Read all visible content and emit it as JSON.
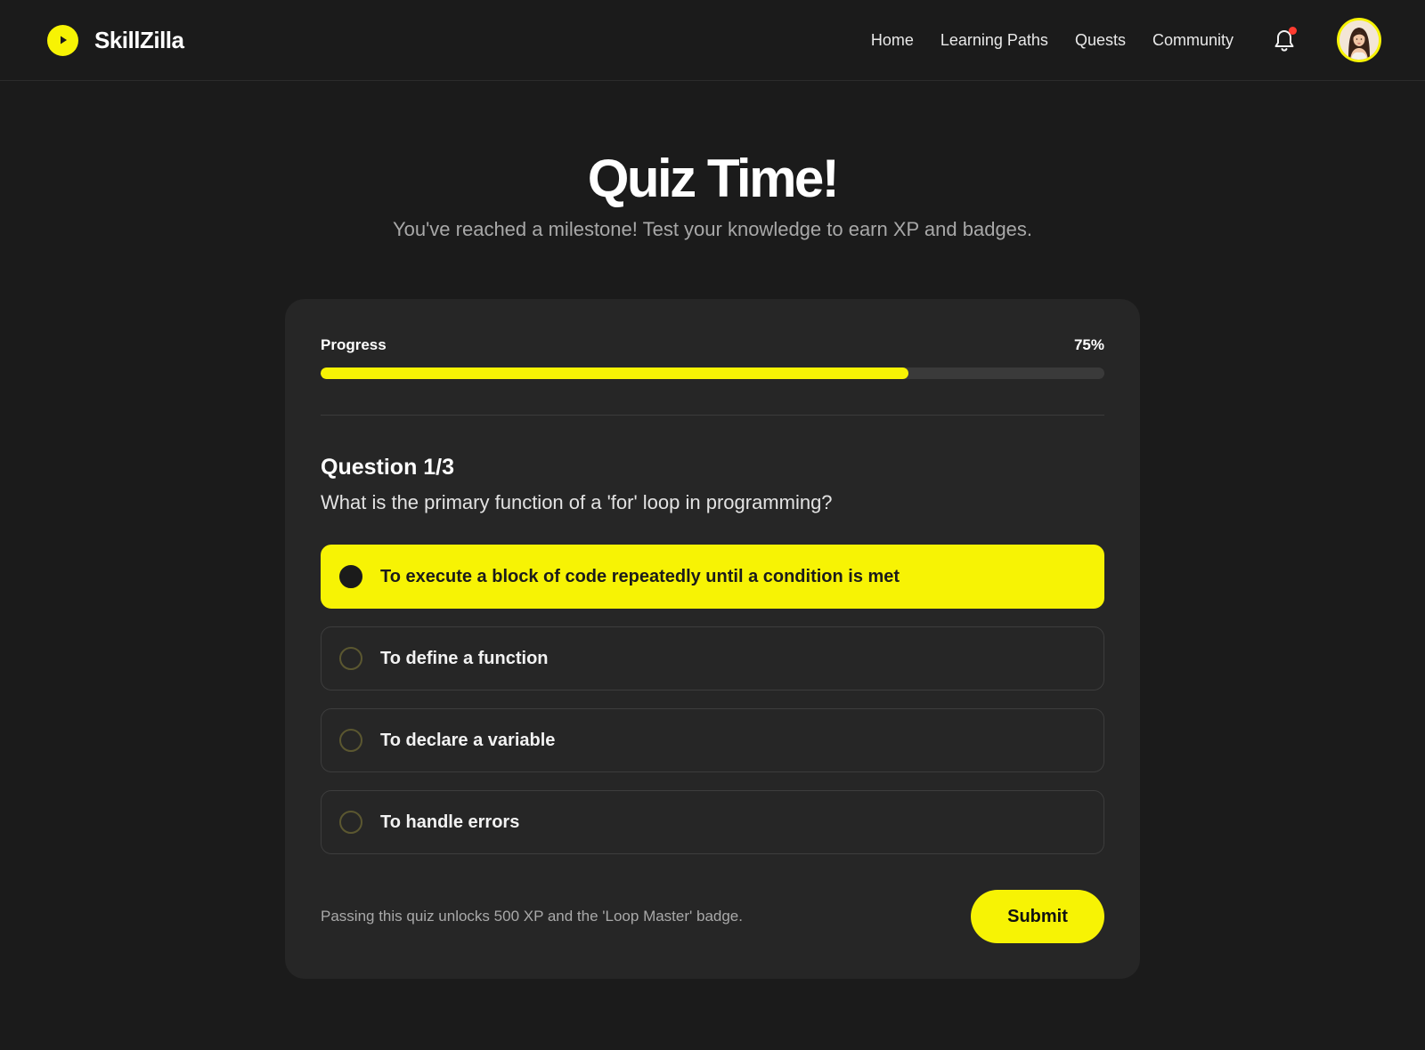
{
  "brand": {
    "name": "SkillZilla",
    "logo_icon": "play-icon",
    "accent": "#f7f304"
  },
  "nav": {
    "links": [
      "Home",
      "Learning Paths",
      "Quests",
      "Community"
    ],
    "notification_icon": "bell-icon",
    "has_unread": true,
    "avatar_icon": "user-avatar"
  },
  "hero": {
    "title": "Quiz Time!",
    "subtitle": "You've reached a milestone! Test your knowledge to earn XP and badges."
  },
  "quiz": {
    "progress_label": "Progress",
    "progress_text": "75%",
    "progress_value": 0.75,
    "question_label": "Question 1/3",
    "question_text": "What is the primary function of a 'for' loop in programming?",
    "options": [
      {
        "label": "To execute a block of code repeatedly until a condition is met",
        "selected": true
      },
      {
        "label": "To define a function",
        "selected": false
      },
      {
        "label": "To declare a variable",
        "selected": false
      },
      {
        "label": "To handle errors",
        "selected": false
      }
    ],
    "footer_note": "Passing this quiz unlocks 500 XP and the 'Loop Master' badge.",
    "submit_label": "Submit"
  }
}
